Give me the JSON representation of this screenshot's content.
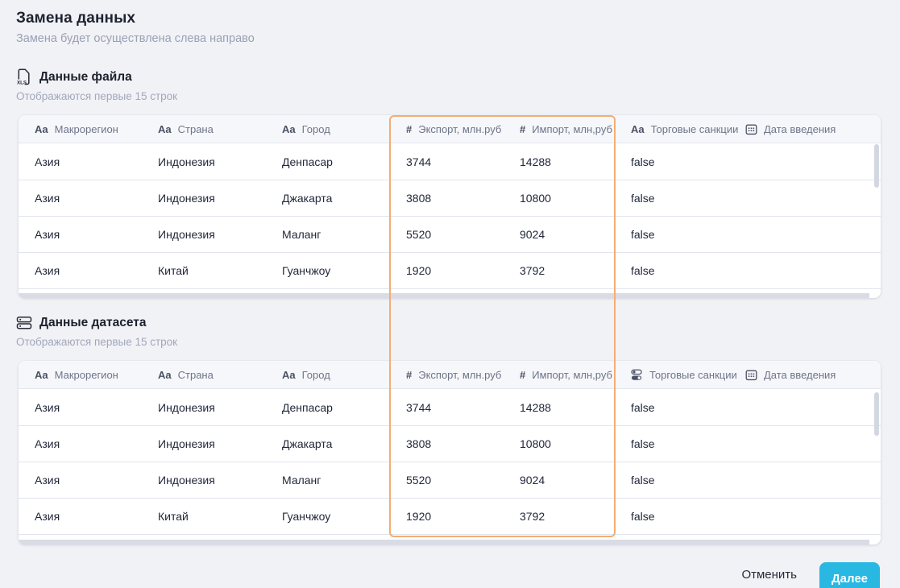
{
  "page": {
    "title": "Замена данных",
    "subtitle": "Замена будет осуществлена слева направо"
  },
  "tables": [
    {
      "title": "Данные файла",
      "subtitle": "Отображаются первые 15 строк",
      "icon": "xls-file-icon",
      "columns": [
        {
          "key": "macroregion",
          "type": "text",
          "label": "Макрорегион"
        },
        {
          "key": "country",
          "type": "text",
          "label": "Страна"
        },
        {
          "key": "city",
          "type": "text",
          "label": "Город"
        },
        {
          "key": "export",
          "type": "number",
          "label": "Экспорт, млн.руб"
        },
        {
          "key": "import",
          "type": "number",
          "label": "Импорт, млн,руб"
        },
        {
          "key": "sanctions",
          "type": "text",
          "label": "Торговые санкции"
        },
        {
          "key": "date",
          "type": "calendar",
          "label": "Дата введения"
        }
      ],
      "rows": [
        [
          "Азия",
          "Индонезия",
          "Денпасар",
          "3744",
          "14288",
          "false",
          ""
        ],
        [
          "Азия",
          "Индонезия",
          "Джакарта",
          "3808",
          "10800",
          "false",
          ""
        ],
        [
          "Азия",
          "Индонезия",
          "Маланг",
          "5520",
          "9024",
          "false",
          ""
        ],
        [
          "Азия",
          "Китай",
          "Гуанчжоу",
          "1920",
          "3792",
          "false",
          ""
        ]
      ]
    },
    {
      "title": "Данные датасета",
      "subtitle": "Отображаются первые 15 строк",
      "icon": "database-icon",
      "columns": [
        {
          "key": "macroregion",
          "type": "text",
          "label": "Макрорегион"
        },
        {
          "key": "country",
          "type": "text",
          "label": "Страна"
        },
        {
          "key": "city",
          "type": "text",
          "label": "Город"
        },
        {
          "key": "export",
          "type": "number",
          "label": "Экспорт, млн.руб"
        },
        {
          "key": "import",
          "type": "number",
          "label": "Импорт, млн,руб"
        },
        {
          "key": "sanctions",
          "type": "toggle",
          "label": "Торговые санкции"
        },
        {
          "key": "date",
          "type": "calendar",
          "label": "Дата введения"
        }
      ],
      "rows": [
        [
          "Азия",
          "Индонезия",
          "Денпасар",
          "3744",
          "14288",
          "false",
          ""
        ],
        [
          "Азия",
          "Индонезия",
          "Джакарта",
          "3808",
          "10800",
          "false",
          ""
        ],
        [
          "Азия",
          "Индонезия",
          "Маланг",
          "5520",
          "9024",
          "false",
          ""
        ],
        [
          "Азия",
          "Китай",
          "Гуанчжоу",
          "1920",
          "3792",
          "false",
          ""
        ]
      ]
    }
  ],
  "highlight": {
    "columns": [
      "export",
      "import"
    ],
    "color": "#F2AE74"
  },
  "footer": {
    "cancel_label": "Отменить",
    "next_label": "Далее"
  },
  "colors": {
    "accent": "#F2AE74",
    "primary_button": "#29B8E2"
  }
}
